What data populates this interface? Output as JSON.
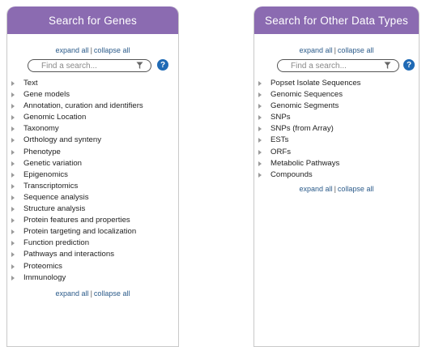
{
  "genes_panel": {
    "title": "Search for Genes",
    "expand_all": "expand all",
    "separator": "|",
    "collapse_all": "collapse all",
    "search_placeholder": "Find a search...",
    "help_label": "?",
    "categories": [
      "Text",
      "Gene models",
      "Annotation, curation and identifiers",
      "Genomic Location",
      "Taxonomy",
      "Orthology and synteny",
      "Phenotype",
      "Genetic variation",
      "Epigenomics",
      "Transcriptomics",
      "Sequence analysis",
      "Structure analysis",
      "Protein features and properties",
      "Protein targeting and localization",
      "Function prediction",
      "Pathways and interactions",
      "Proteomics",
      "Immunology"
    ]
  },
  "other_panel": {
    "title": "Search for Other Data Types",
    "expand_all": "expand all",
    "separator": "|",
    "collapse_all": "collapse all",
    "search_placeholder": "Find a search...",
    "help_label": "?",
    "categories": [
      "Popset Isolate Sequences",
      "Genomic Sequences",
      "Genomic Segments",
      "SNPs",
      "SNPs (from Array)",
      "ESTs",
      "ORFs",
      "Metabolic Pathways",
      "Compounds"
    ]
  },
  "colors": {
    "header_purple": "#8b6bb1",
    "link_blue": "#2b5b8a",
    "help_blue": "#1f6ab5"
  },
  "icons": [
    "filter-icon",
    "help-icon",
    "expand-arrow-icon"
  ]
}
